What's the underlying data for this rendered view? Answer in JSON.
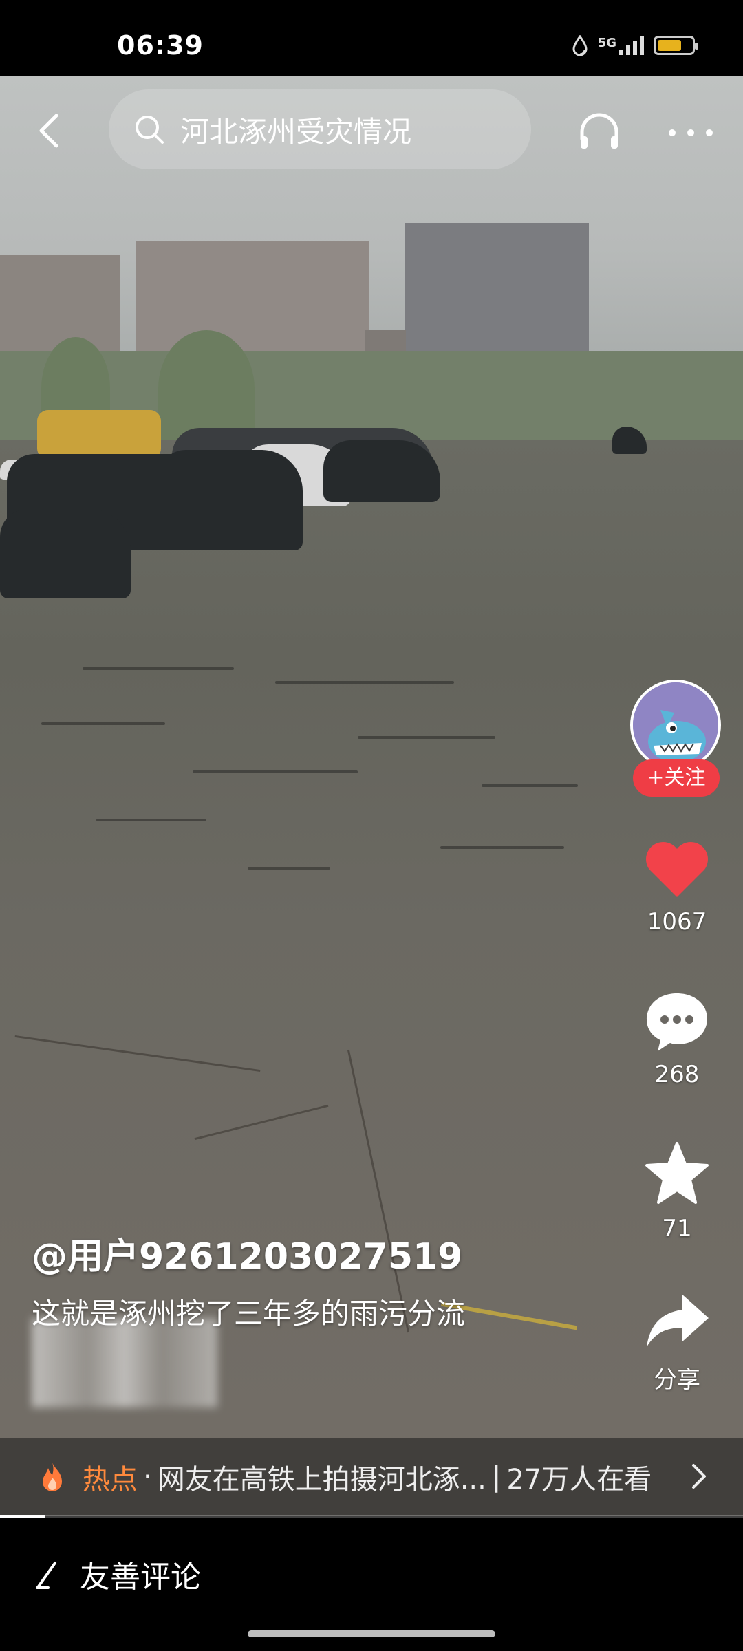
{
  "status_bar": {
    "time": "06:39",
    "network": "5G",
    "battery_level": 0.7
  },
  "nav": {
    "back_icon": "chevron-left-icon",
    "search_text": "河北涿州受灾情况",
    "search_icon": "search-icon",
    "listen_icon": "headphones-icon",
    "more_icon": "more-horizontal-icon"
  },
  "rail": {
    "follow_label": "+关注",
    "likes": "1067",
    "comments": "268",
    "favorites": "71",
    "share_label": "分享",
    "like_color": "#f2424a",
    "follow_color": "#ef3d45"
  },
  "post": {
    "author": "@用户9261203027519",
    "caption": "这就是涿州挖了三年多的雨污分流"
  },
  "hot": {
    "label": "热点",
    "dot": "·",
    "text": "网友在高铁上拍摄河北涿...",
    "separator": "|",
    "viewers": "27万人在看",
    "label_color": "#ff8a3d"
  },
  "bottom": {
    "comment_prompt": "友善评论",
    "progress": 0.06
  }
}
